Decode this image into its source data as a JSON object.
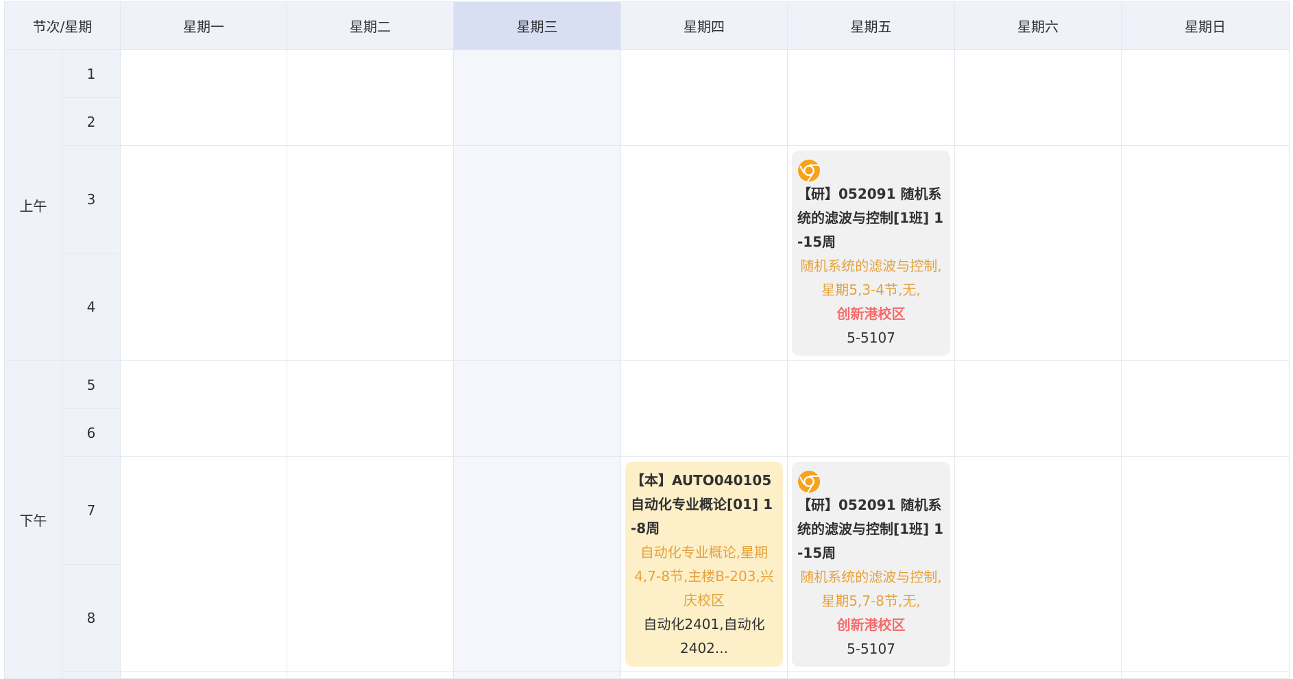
{
  "header": {
    "corner": "节次/星期",
    "days": [
      "星期一",
      "星期二",
      "星期三",
      "星期四",
      "星期五",
      "星期六",
      "星期日"
    ]
  },
  "periods": {
    "morning": "上午",
    "afternoon": "下午"
  },
  "sections": [
    "1",
    "2",
    "3",
    "4",
    "5",
    "6",
    "7",
    "8"
  ],
  "courses": {
    "fri_am": {
      "icon": "chrome-icon",
      "title": "【研】052091 随机系统的滤波与控制[1班] 1-15周",
      "info": "随机系统的滤波与控制,星期5,3-4节,无,",
      "campus": "创新港校区",
      "room": "5-5107"
    },
    "thu_pm": {
      "title": "【本】AUTO040105 自动化专业概论[01] 1-8周",
      "info": "自动化专业概论,星期4,7-8节,主楼B-203,兴庆校区",
      "classes": "自动化2401,自动化2402..."
    },
    "fri_pm": {
      "icon": "chrome-icon",
      "title": "【研】052091 随机系统的滤波与控制[1班] 1-15周",
      "info": "随机系统的滤波与控制,星期5,7-8节,无,",
      "campus": "创新港校区",
      "room": "5-5107"
    }
  },
  "colors": {
    "header_bg": "#f0f2fa",
    "today_header_bg": "#d9dff2",
    "graduate_card_bg": "#f1f1f1",
    "undergrad_card_bg": "#fdefc8",
    "info_text": "#e6a23c",
    "campus_text": "#f56c6c"
  }
}
